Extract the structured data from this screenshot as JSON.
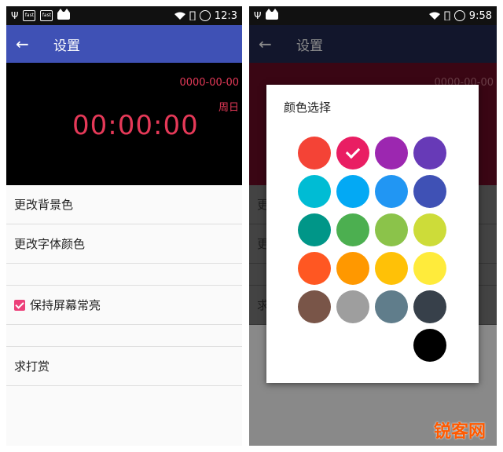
{
  "left": {
    "status_time": "12:3",
    "status_fast": "fast",
    "toolbar_title": "设置",
    "clock_date": "0000-00-00",
    "clock_weekday": "周日",
    "clock_time": "00:00:00",
    "settings": [
      {
        "label": "更改背景色"
      },
      {
        "label": "更改字体颜色"
      },
      {
        "label": ""
      },
      {
        "label": "保持屏幕常亮",
        "checked": true
      },
      {
        "label": ""
      },
      {
        "label": "求打赏"
      }
    ]
  },
  "right": {
    "status_time": "9:58",
    "toolbar_title": "设置",
    "clock_date": "0000-00-00",
    "settings_peek": [
      "更",
      "更",
      "求"
    ],
    "dialog_title": "颜色选择",
    "selected_color": "#e91e63",
    "colors": [
      "#f44336",
      "#e91e63",
      "#9c27b0",
      "#673ab7",
      "#00bcd4",
      "#03a9f4",
      "#2196f3",
      "#3f51b5",
      "#009688",
      "#4caf50",
      "#8bc34a",
      "#cddc39",
      "#ff5722",
      "#ff9800",
      "#ffc107",
      "#ffeb3b",
      "#795548",
      "#9e9e9e",
      "#607d8b",
      "#37404a",
      "#000000"
    ]
  },
  "watermark": "锐客网"
}
